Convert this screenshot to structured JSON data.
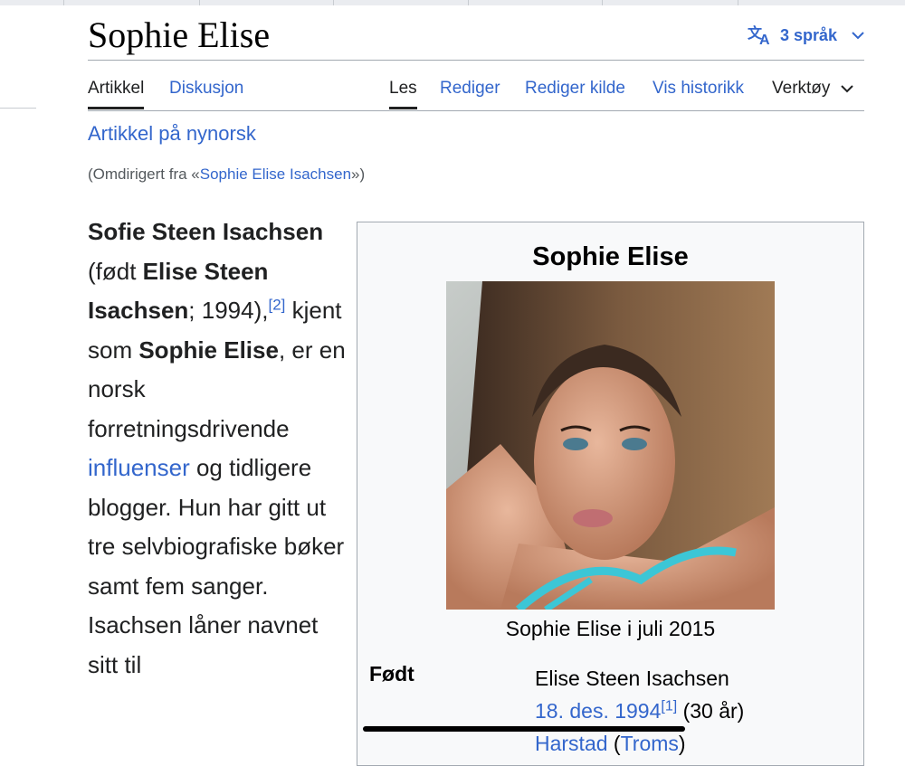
{
  "header": {
    "title": "Sophie Elise",
    "languages_label": "3 språk"
  },
  "tabs": {
    "left": [
      {
        "label": "Artikkel",
        "selected": true
      },
      {
        "label": "Diskusjon",
        "selected": false
      }
    ],
    "right": [
      {
        "label": "Les",
        "selected": true
      },
      {
        "label": "Rediger",
        "selected": false
      },
      {
        "label": "Rediger kilde",
        "selected": false
      },
      {
        "label": "Vis historikk",
        "selected": false
      },
      {
        "label": "Verktøy",
        "selected": false
      }
    ]
  },
  "nynorsk_link": "Artikkel på nynorsk",
  "redirect": {
    "prefix": "(Omdirigert fra «",
    "link": "Sophie Elise Isachsen",
    "suffix": "»)"
  },
  "lead": {
    "name1": "Sofie Steen Isachsen",
    "t1": " (født ",
    "name2": "Elise Steen Isachsen",
    "t2": "; 1994),",
    "ref": "[2]",
    "t3": " kjent som ",
    "name3": "Sophie Elise",
    "t4": ", er en norsk forretningsdrivende ",
    "link": "influenser",
    "t5": " og tidligere blogger. Hun har gitt ut tre selvbiografiske bøker samt fem sanger. Isachsen låner navnet sitt til"
  },
  "infobox": {
    "title": "Sophie Elise",
    "caption": "Sophie Elise i juli 2015",
    "born_label": "Født",
    "born_name": "Elise Steen Isachsen",
    "born_date": "18. des. 1994",
    "born_ref": "[1]",
    "born_age": " (30 år)",
    "born_place": "Harstad",
    "born_region": "Troms"
  },
  "colors": {
    "link": "#3366cc",
    "text": "#202122",
    "border": "#a2a9b1",
    "infobox_bg": "#f8f9fa"
  }
}
